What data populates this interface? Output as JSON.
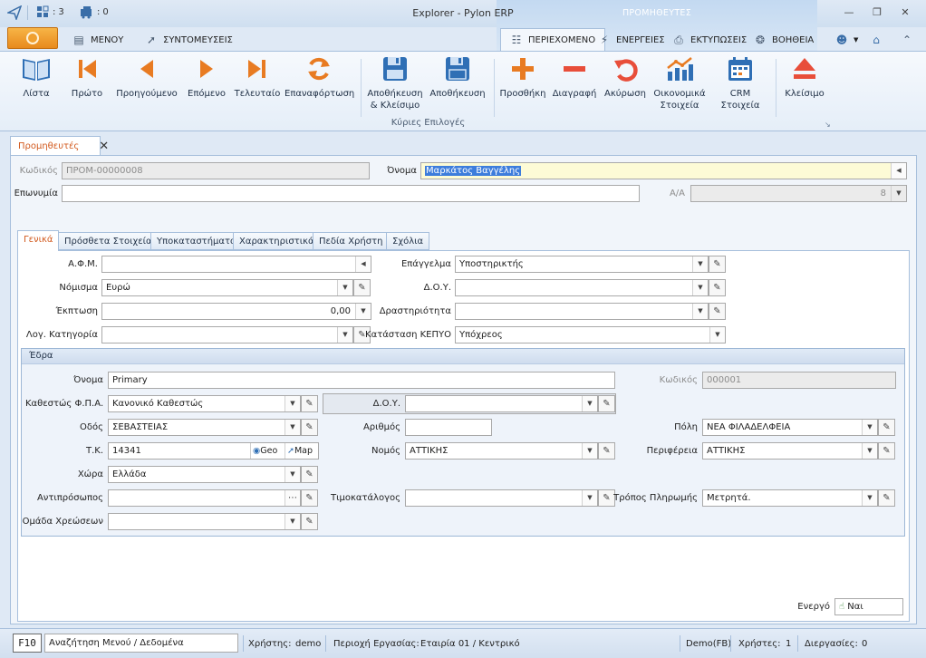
{
  "titlebar": {
    "title": "Explorer - Pylon ERP",
    "context_title": "ΠΡΟΜΗΘΕΥΤΕΣ",
    "windows_count": "3",
    "tasks_count": "0"
  },
  "menu": {
    "menu_label": "ΜΕΝΟΥ",
    "shortcuts_label": "ΣΥΝΤΟΜΕΥΣΕΙΣ",
    "content_label": "ΠΕΡΙΕΧΟΜΕΝΟ",
    "actions_label": "ΕΝΕΡΓΕΙΕΣ",
    "prints_label": "ΕΚΤΥΠΩΣΕΙΣ",
    "help_label": "ΒΟΗΘΕΙΑ"
  },
  "ribbon": {
    "group_label": "Κύριες Επιλογές",
    "list": "Λίστα",
    "first": "Πρώτο",
    "previous": "Προηγούμενο",
    "next": "Επόμενο",
    "last": "Τελευταίο",
    "refresh": "Επαναφόρτωση",
    "save_close_1": "Αποθήκευση",
    "save_close_2": "& Κλείσιμο",
    "save": "Αποθήκευση",
    "add": "Προσθήκη",
    "delete": "Διαγραφή",
    "cancel": "Ακύρωση",
    "finance_1": "Οικονομικά",
    "finance_2": "Στοιχεία",
    "crm": "CRM Στοιχεία",
    "close": "Κλείσιμο"
  },
  "doc_tab": "Προμηθευτές",
  "header_form": {
    "code_label": "Κωδικός",
    "code_value": "ΠΡΟΜ-00000008",
    "name_label": "Όνομα",
    "name_value": "Μαρκάτος Βαγγέλης",
    "company_label": "Επωνυμία",
    "company_value": "",
    "aa_label": "Α/Α",
    "aa_value": "8"
  },
  "inner_tabs": [
    "Γενικά",
    "Πρόσθετα Στοιχεία",
    "Υποκαταστήματα",
    "Χαρακτηριστικά",
    "Πεδία Χρήστη",
    "Σχόλια"
  ],
  "general": {
    "afm_label": "Α.Φ.Μ.",
    "afm_value": "",
    "currency_label": "Νόμισμα",
    "currency_value": "Ευρώ",
    "discount_label": "Έκπτωση",
    "discount_value": "0,00",
    "category_label": "Λογ. Κατηγορία",
    "category_value": "",
    "profession_label": "Επάγγελμα",
    "profession_value": "Υποστηρικτής",
    "doy_label": "Δ.Ο.Υ.",
    "doy_value": "",
    "activity_label": "Δραστηριότητα",
    "activity_value": "",
    "kepyo_label": "Κατάσταση ΚΕΠΥΟ",
    "kepyo_value": "Υπόχρεος"
  },
  "hq": {
    "title": "Έδρα",
    "name_label": "Όνομα",
    "name_value": "Primary",
    "code_label": "Κωδικός",
    "code_value": "000001",
    "vat_label": "Καθεστώς Φ.Π.Α.",
    "vat_value": "Κανονικό Καθεστώς",
    "doy_label": "Δ.Ο.Υ.",
    "doy_value": "",
    "street_label": "Οδός",
    "street_value": "ΣΕΒΑΣΤΕΙΑΣ",
    "number_label": "Αριθμός",
    "number_value": "",
    "city_label": "Πόλη",
    "city_value": "ΝΕΑ ΦΙΛΑΔΕΛΦΕΙΑ",
    "zip_label": "Τ.Κ.",
    "zip_value": "14341",
    "geo_label": "Geo",
    "map_label": "Map",
    "prefecture_label": "Νομός",
    "prefecture_value": "ΑΤΤΙΚΗΣ",
    "region_label": "Περιφέρεια",
    "region_value": "ΑΤΤΙΚΗΣ",
    "country_label": "Χώρα",
    "country_value": "Ελλάδα",
    "rep_label": "Αντιπρόσωπος",
    "rep_value": "",
    "pricelist_label": "Τιμοκατάλογος",
    "pricelist_value": "",
    "payment_label": "Τρόπος Πληρωμής",
    "payment_value": "Μετρητά.",
    "charges_label": "Ομάδα Χρεώσεων",
    "charges_value": ""
  },
  "active": {
    "label": "Ενεργό",
    "value": "Ναι"
  },
  "status": {
    "f10": "F10",
    "search": "Αναζήτηση Μενού / Δεδομένα",
    "user_label": "Χρήστης:",
    "user_value": "demo",
    "workspace_label": "Περιοχή Εργασίας:",
    "workspace_value": "Εταιρία 01 / Κεντρικό",
    "db": "Demo(FB)",
    "users_label": "Χρήστες:",
    "users_value": "1",
    "processes_label": "Διεργασίες:",
    "processes_value": "0"
  },
  "colors": {
    "accent": "#e88a1d",
    "selection": "#3d7ddc",
    "active_tab_text": "#d25a1e"
  }
}
